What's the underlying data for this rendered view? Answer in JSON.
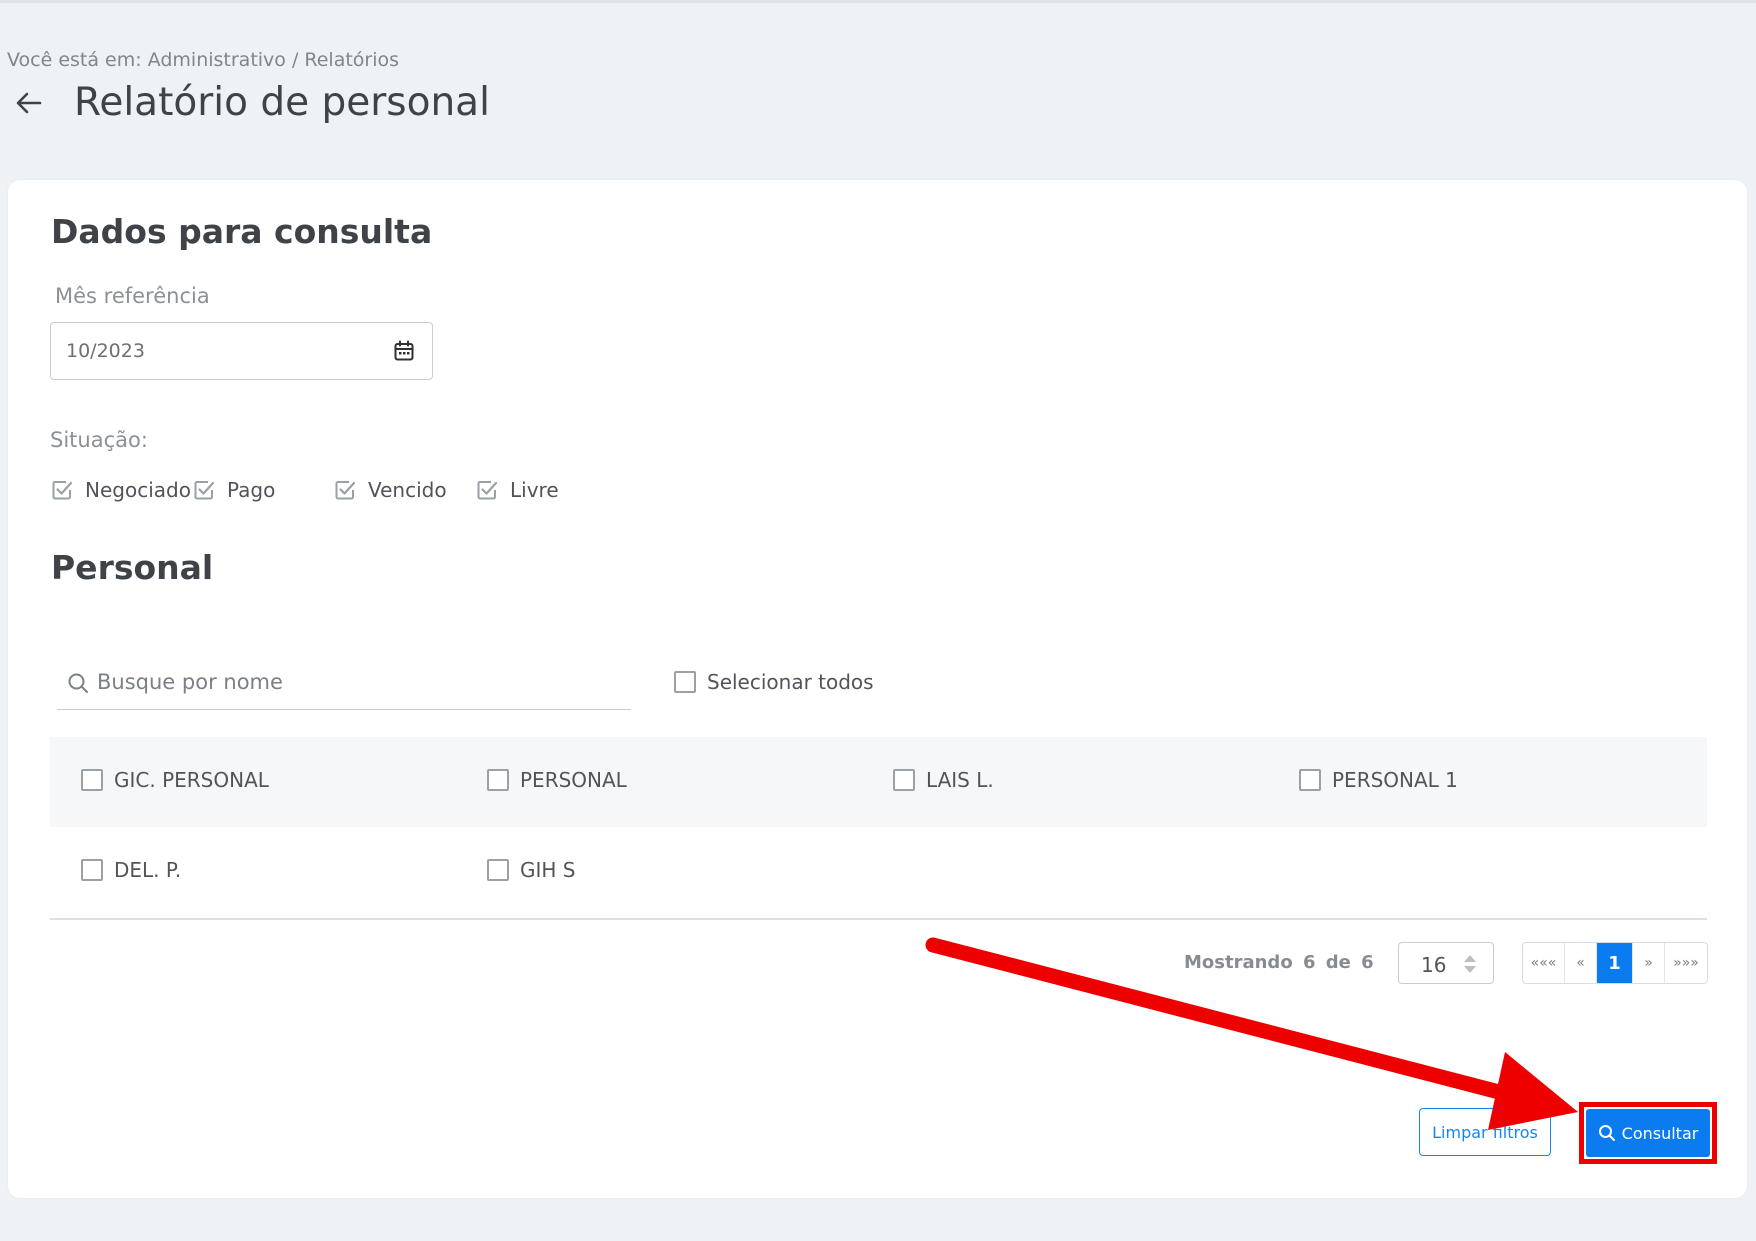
{
  "breadcrumb": {
    "text": "Você está em: Administrativo / Relatórios"
  },
  "header": {
    "title": "Relatório de personal",
    "back_icon": "arrow-left-icon"
  },
  "consulta": {
    "title": "Dados para consulta",
    "mes_label": "Mês referência",
    "mes_value": "10/2023",
    "situacao_label": "Situação:",
    "situacoes": [
      {
        "label": "Negociado",
        "checked": true
      },
      {
        "label": "Pago",
        "checked": true
      },
      {
        "label": "Vencido",
        "checked": true
      },
      {
        "label": "Livre",
        "checked": true
      }
    ]
  },
  "personal": {
    "title": "Personal",
    "search_placeholder": "Busque por nome",
    "select_all_label": "Selecionar todos",
    "items": [
      {
        "label": "GIC. PERSONAL",
        "checked": false
      },
      {
        "label": "PERSONAL",
        "checked": false
      },
      {
        "label": "LAIS L.",
        "checked": false
      },
      {
        "label": "PERSONAL 1",
        "checked": false
      },
      {
        "label": "DEL. P.",
        "checked": false
      },
      {
        "label": "GIH S",
        "checked": false
      }
    ]
  },
  "pagination": {
    "showing_text": "Mostrando 6 de 6",
    "page_size": "16",
    "first": "«««",
    "prev": "«",
    "current": "1",
    "next": "»",
    "last": "»»»"
  },
  "actions": {
    "clear_label": "Limpar filtros",
    "consultar_label": "Consultar"
  },
  "colors": {
    "primary": "#0a7cf0",
    "annotation_red": "#ee0000",
    "background": "#eef1f5"
  }
}
